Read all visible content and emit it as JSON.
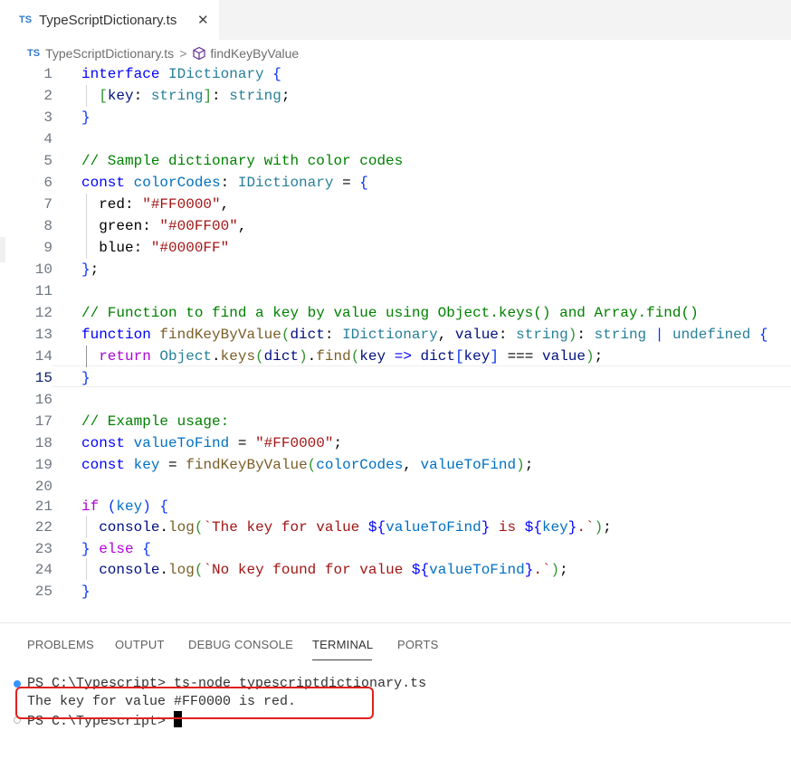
{
  "tab": {
    "badge": "TS",
    "name": "TypeScriptDictionary.ts",
    "close": "✕"
  },
  "breadcrumb": {
    "badge": "TS",
    "file": "TypeScriptDictionary.ts",
    "separator": ">",
    "symbol": "findKeyByValue"
  },
  "editor": {
    "active_line": 15,
    "line_numbers": [
      "1",
      "2",
      "3",
      "4",
      "5",
      "6",
      "7",
      "8",
      "9",
      "10",
      "11",
      "12",
      "13",
      "14",
      "15",
      "16",
      "17",
      "18",
      "19",
      "20",
      "21",
      "22",
      "23",
      "24",
      "25"
    ]
  },
  "panel": {
    "tabs": [
      {
        "label": "PROBLEMS"
      },
      {
        "label": "OUTPUT"
      },
      {
        "label": "DEBUG CONSOLE"
      },
      {
        "label": "TERMINAL",
        "active": true
      },
      {
        "label": "PORTS"
      }
    ],
    "terminal": {
      "line1": "PS C:\\Typescript> ts-node typescriptdictionary.ts",
      "line2": "The key for value #FF0000 is red.",
      "line3": "PS C:\\Typescript> "
    }
  },
  "colors": {
    "keyword": "#0000ff",
    "type": "#267f99",
    "string": "#a31515",
    "comment": "#008000",
    "function": "#795e26",
    "highlight_box": "#e0201b",
    "dot_success": "#3794ff"
  }
}
